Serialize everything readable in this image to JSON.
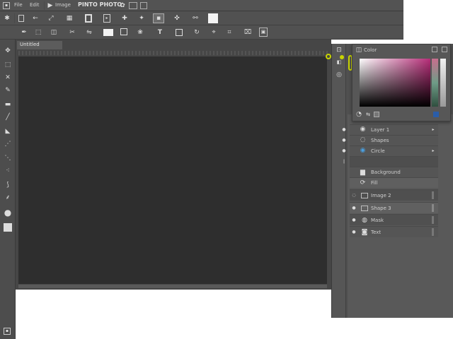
{
  "menubar": {
    "items": [
      "File",
      "Edit",
      "Image"
    ],
    "title": "PINTO PHOTO"
  },
  "document": {
    "tab_label": "Untitled"
  },
  "color_panel": {
    "title": "Color"
  },
  "layers": {
    "rows": [
      {
        "label": "Layer 1"
      },
      {
        "label": "Shapes"
      },
      {
        "label": "Circle"
      },
      {
        "label": ""
      },
      {
        "label": "Background"
      },
      {
        "label": "Fill"
      }
    ],
    "items": [
      {
        "label": "Image 2"
      },
      {
        "label": "Shape 3"
      },
      {
        "label": "Mask"
      },
      {
        "label": "Text"
      }
    ]
  },
  "colors": {
    "ui_dark": "#3c3c3c",
    "ui_mid": "#595959",
    "canvas": "#2e2e2e",
    "highlight": "#c8d400"
  },
  "icons": [
    "move-icon",
    "marquee-icon",
    "lasso-icon",
    "crop-icon",
    "brush-icon",
    "eraser-icon",
    "zoom-icon",
    "hand-icon"
  ]
}
